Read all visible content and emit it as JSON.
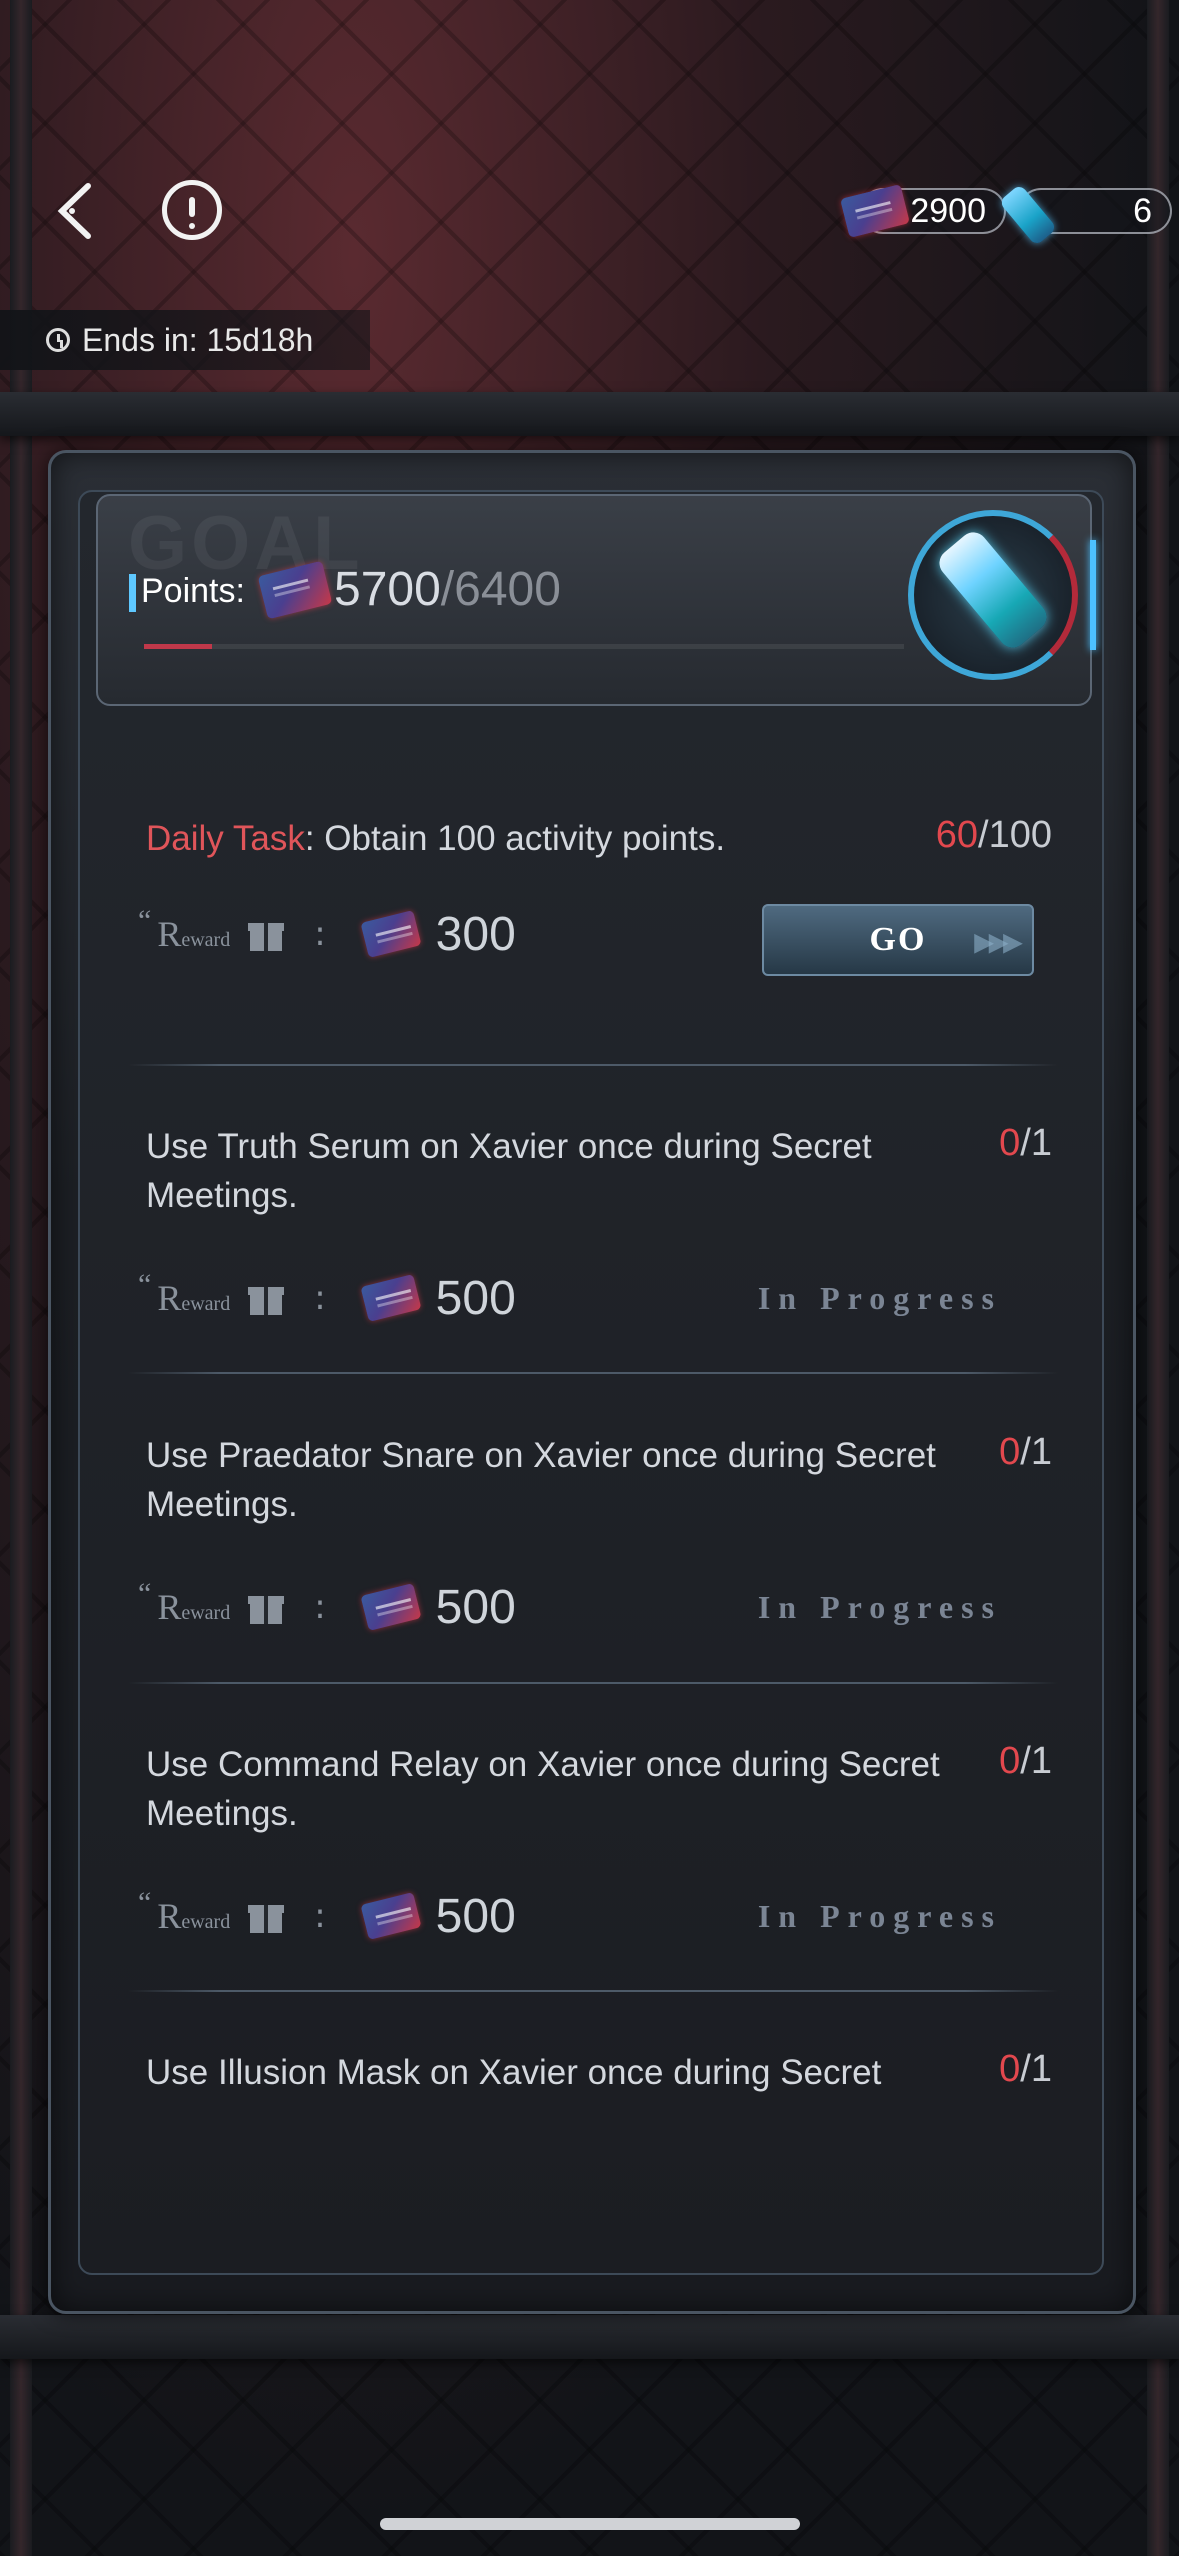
{
  "header": {
    "currency_a": "2900",
    "currency_b": "6",
    "ends_in": "Ends in: 15d18h"
  },
  "goal": {
    "bg_text": "GOAL",
    "points_label": "Points:",
    "current": "5700",
    "separator": "/",
    "total": "6400",
    "progress": 0.09
  },
  "tasks": [
    {
      "prefix": "Daily Task",
      "title": ": Obtain 100 activity points.",
      "count_current": "60",
      "count_sep": "/",
      "count_total": "100",
      "reward_amount": "300",
      "action": "GO"
    },
    {
      "title": "Use Truth Serum on Xavier once during Secret Meetings.",
      "count_current": "0",
      "count_sep": "/",
      "count_total": "1",
      "reward_amount": "500",
      "status": "In Progress"
    },
    {
      "title": "Use Praedator Snare on Xavier once during Secret Meetings.",
      "count_current": "0",
      "count_sep": "/",
      "count_total": "1",
      "reward_amount": "500",
      "status": "In Progress"
    },
    {
      "title": "Use Command Relay on Xavier once during Secret Meetings.",
      "count_current": "0",
      "count_sep": "/",
      "count_total": "1",
      "reward_amount": "500",
      "status": "In Progress"
    },
    {
      "title": "Use Illusion Mask on Xavier once during Secret",
      "count_current": "0",
      "count_sep": "/",
      "count_total": "1"
    }
  ],
  "reward": {
    "quote": "“",
    "R": "R",
    "rest": "eward",
    "colon": ":"
  },
  "colors": {
    "accent_red": "#e2484e",
    "accent_blue": "#4cc1ff"
  },
  "icons": [
    "back-chevron-icon",
    "info-icon",
    "card-ticket-icon",
    "vial-icon",
    "clock-icon",
    "gift-icon"
  ]
}
